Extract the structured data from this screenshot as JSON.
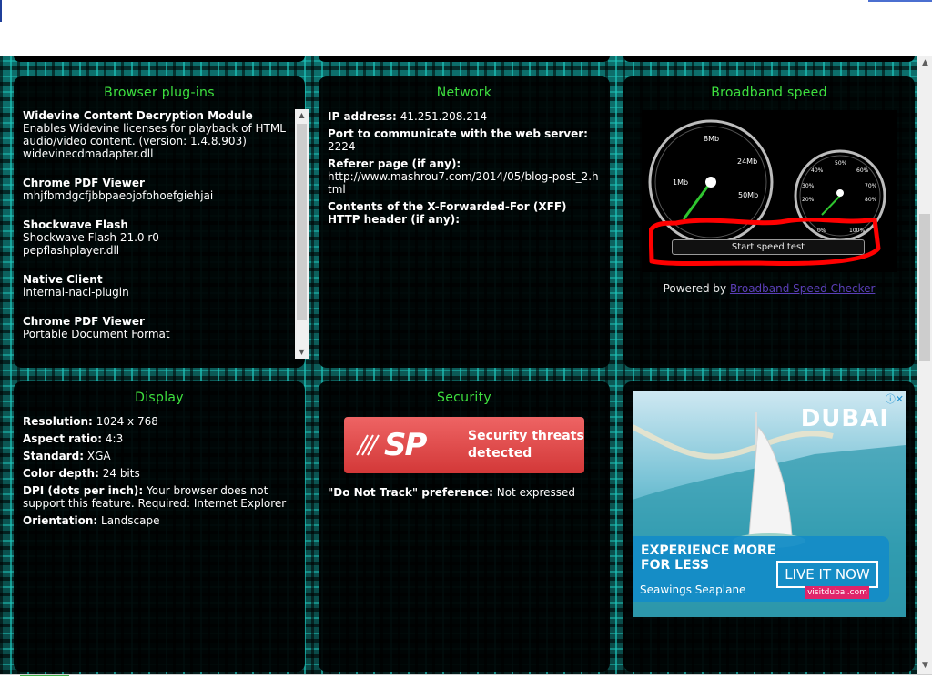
{
  "browser_plugins": {
    "title": "Browser plug-ins",
    "items": [
      {
        "name": "Widevine Content Decryption Module",
        "description": "Enables Widevine licenses for playback of HTML audio/video content. (version: 1.4.8.903)",
        "file": "widevinecdmadapter.dll"
      },
      {
        "name": "Chrome PDF Viewer",
        "description": "",
        "file": "mhjfbmdgcfjbbpaeojofohoefgiehjai"
      },
      {
        "name": "Shockwave Flash",
        "description": "Shockwave Flash 21.0 r0",
        "file": "pepflashplayer.dll"
      },
      {
        "name": "Native Client",
        "description": "",
        "file": "internal-nacl-plugin"
      },
      {
        "name": "Chrome PDF Viewer",
        "description": "Portable Document Format",
        "file": ""
      }
    ]
  },
  "network": {
    "title": "Network",
    "ip_label": "IP address:",
    "ip_value": "41.251.208.214",
    "port_label": "Port to communicate with the web server:",
    "port_value": "2224",
    "referer_label": "Referer page (if any):",
    "referer_value": "http://www.mashrou7.com/2014/05/blog-post_2.html",
    "xff_label": "Contents of the X-Forwarded-For (XFF) HTTP header (if any):",
    "xff_value": ""
  },
  "broadband": {
    "title": "Broadband speed",
    "gauge_left_labels": [
      "1Mb",
      "8Mb",
      "24Mb",
      "50Mb"
    ],
    "gauge_right_labels": [
      "20%",
      "30%",
      "40%",
      "50%",
      "60%",
      "70%",
      "80%",
      "100%",
      "0%"
    ],
    "button_label": "Start speed test",
    "powered_prefix": "Powered by",
    "powered_link": "Broadband Speed Checker"
  },
  "display": {
    "title": "Display",
    "rows": [
      {
        "label": "Resolution:",
        "value": "1024 x 768"
      },
      {
        "label": "Aspect ratio:",
        "value": "4:3"
      },
      {
        "label": "Standard:",
        "value": "XGA"
      },
      {
        "label": "Color depth:",
        "value": "24 bits"
      },
      {
        "label": "DPI (dots per inch):",
        "value": "Your browser does not support this feature. Required: Internet Explorer"
      },
      {
        "label": "Orientation:",
        "value": "Landscape"
      }
    ]
  },
  "security": {
    "title": "Security",
    "badge_logo": "SP",
    "badge_line1": "Security threats",
    "badge_line2": "detected",
    "dnt_label": "\"Do Not Track\" preference:",
    "dnt_value": "Not expressed"
  },
  "ad": {
    "brand": "DUBAI",
    "headline_line1": "EXPERIENCE MORE",
    "headline_line2": "FOR LESS",
    "cta": "LIVE IT NOW",
    "sub": "Seawings Seaplane",
    "site": "visitdubai.com",
    "close_glyph": "ⓘ✕"
  },
  "colors": {
    "heading": "#3ee03e",
    "panel_bg": "#000000",
    "link": "#5b3fb8",
    "highlight": "#ff0000"
  }
}
